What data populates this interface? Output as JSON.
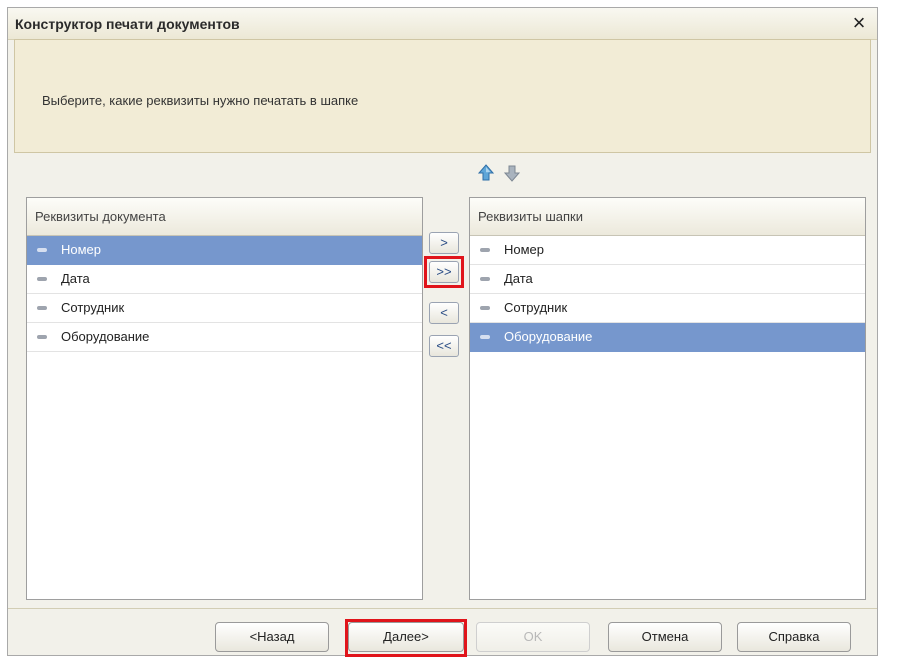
{
  "window": {
    "title": "Конструктор печати документов",
    "close_label": "×"
  },
  "info": {
    "text": "Выберите, какие реквизиты нужно печатать в шапке"
  },
  "order_icons": [
    "arrow-up-icon",
    "arrow-down-icon"
  ],
  "left_list": {
    "header": "Реквизиты документа",
    "items": [
      "Номер",
      "Дата",
      "Сотрудник",
      "Оборудование"
    ],
    "selected_index": 0
  },
  "right_list": {
    "header": "Реквизиты шапки",
    "items": [
      "Номер",
      "Дата",
      "Сотрудник",
      "Оборудование"
    ],
    "selected_index": 3
  },
  "move_buttons": {
    "add": ">",
    "add_all": ">>",
    "remove": "<",
    "remove_all": "<<"
  },
  "footer": {
    "back": "<Назад",
    "next": "Далее>",
    "ok": "OK",
    "cancel": "Отмена",
    "help": "Справка"
  },
  "colors": {
    "selection": "#7697cd",
    "highlight": "#e0141b",
    "panel": "#f2ecd6"
  }
}
